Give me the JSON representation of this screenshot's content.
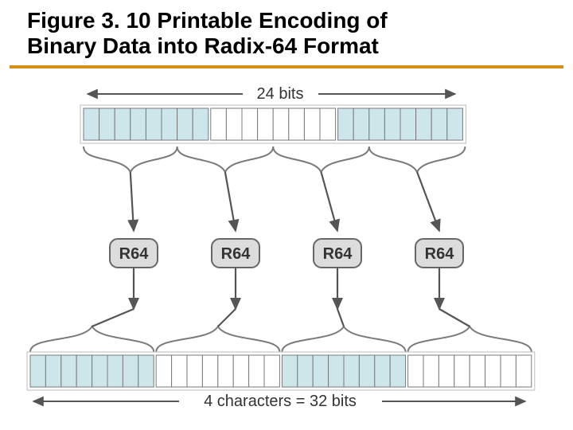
{
  "title_line1": "Figure 3. 10 Printable Encoding of",
  "title_line2": "Binary Data into Radix-64 Format",
  "top_label": "24 bits",
  "bottom_label": "4 characters = 32 bits",
  "node_label": "R64",
  "colors": {
    "shaded": "#cde6ea",
    "stroke": "#7a7a7a",
    "arrow": "#555555",
    "node_fill": "#dcdcdc",
    "rule": "#d4911a"
  },
  "top_row": {
    "groups": 3,
    "bits_per_group": 8
  },
  "bottom_row": {
    "groups": 4,
    "bits_per_group": 8
  },
  "encoders": 4
}
